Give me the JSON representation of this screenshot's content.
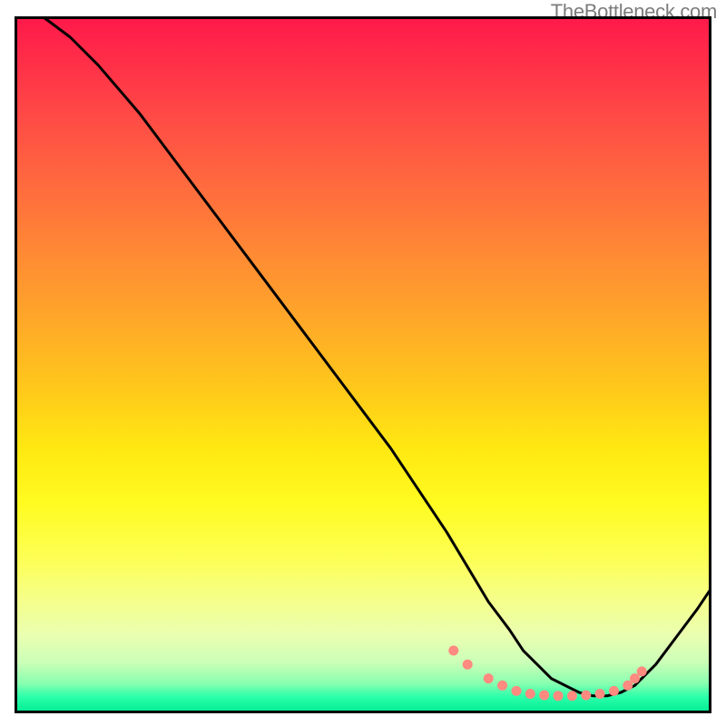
{
  "watermark": "TheBottleneck.com",
  "chart_data": {
    "type": "line",
    "title": "",
    "xlabel": "",
    "ylabel": "",
    "xlim": [
      0,
      100
    ],
    "ylim": [
      0,
      100
    ],
    "grid": false,
    "legend": false,
    "series": [
      {
        "name": "curve",
        "type": "line",
        "color": "#000000",
        "x": [
          4,
          8,
          12,
          18,
          24,
          30,
          36,
          42,
          48,
          54,
          58,
          62,
          65,
          68,
          71,
          73,
          75,
          77,
          79,
          81,
          83,
          85,
          87,
          89,
          92,
          95,
          98,
          100
        ],
        "y": [
          100,
          97,
          93,
          86,
          78,
          70,
          62,
          54,
          46,
          38,
          32,
          26,
          21,
          16,
          12,
          9,
          7,
          5,
          4,
          3,
          2.5,
          2.5,
          3,
          4,
          7,
          11,
          15,
          18
        ]
      },
      {
        "name": "marker-dots",
        "type": "scatter",
        "color": "#ff8a80",
        "x": [
          63,
          65,
          68,
          70,
          72,
          74,
          76,
          78,
          80,
          82,
          84,
          86,
          88,
          89,
          90
        ],
        "y": [
          9,
          7,
          5,
          4,
          3.2,
          2.8,
          2.6,
          2.5,
          2.5,
          2.6,
          2.8,
          3.2,
          4,
          5,
          6
        ]
      }
    ]
  }
}
